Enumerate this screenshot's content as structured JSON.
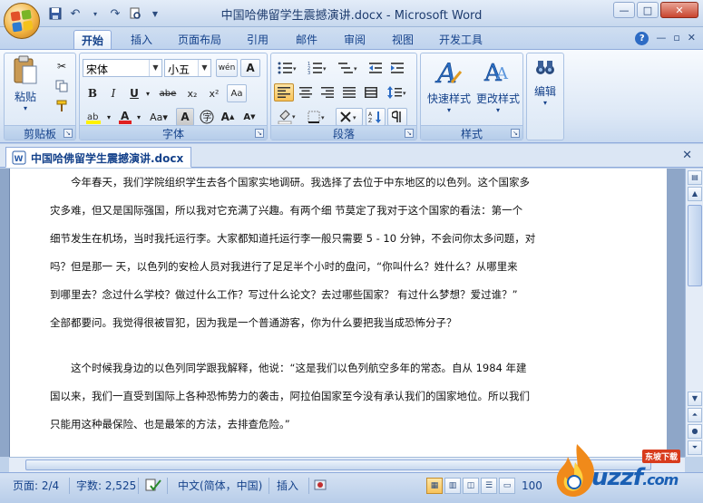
{
  "window": {
    "title": "中国哈佛留学生震撼演讲.docx - Microsoft Word",
    "controls": {
      "minimize": "—",
      "maximize": "□",
      "close": "✕"
    }
  },
  "qat": {
    "save": "save-icon",
    "undo": "undo-icon",
    "redo": "redo-icon",
    "customize": "▼"
  },
  "tabs": [
    {
      "label": "开始",
      "active": true
    },
    {
      "label": "插入"
    },
    {
      "label": "页面布局"
    },
    {
      "label": "引用"
    },
    {
      "label": "邮件"
    },
    {
      "label": "审阅"
    },
    {
      "label": "视图"
    },
    {
      "label": "开发工具"
    }
  ],
  "ribbon": {
    "clipboard": {
      "label": "剪贴板",
      "paste": "粘贴"
    },
    "font": {
      "label": "字体",
      "font_name": "宋体",
      "font_size": "小五",
      "wen": "wén",
      "A_big": "A",
      "bold": "B",
      "italic": "I",
      "underline": "U",
      "strike": "abe",
      "subscript": "x₂",
      "superscript": "x²",
      "clear": "Aa"
    },
    "paragraph": {
      "label": "段落"
    },
    "styles": {
      "label": "样式",
      "quick_styles": "快速样式",
      "change_styles": "更改样式"
    },
    "editing": {
      "label": "编辑",
      "edit": "编辑"
    }
  },
  "doc_tab": {
    "label": "中国哈佛留学生震撼演讲.docx",
    "close": "✕"
  },
  "document": {
    "paragraphs": [
      {
        "lines": [
          "　　今年春天，我们学院组织学生去各个国家实地调研。我选择了去位于中东地区的以色列。这个国家多",
          "灾多难，但又是国际强国，所以我对它充满了兴趣。有两个细 节莫定了我对于这个国家的看法：第一个",
          "细节发生在机场，当时我托运行李。大家都知道托运行李一般只需要 5 - 10 分钟，不会问你太多问题，对",
          "吗？但是那一 天，以色列的安检人员对我进行了足足半个小时的盘问，“你叫什么？姓什么？从哪里来",
          "到哪里去？念过什么学校？做过什么工作？写过什么论文？去过哪些国家？ 有过什么梦想？爱过谁？”",
          "全部都要问。我觉得很被冒犯，因为我是一个普通游客，你为什么要把我当成恐怖分子？"
        ]
      },
      {
        "lines": [
          "　　这个时候我身边的以色列同学跟我解释，他说：“这是我们以色列航空多年的常态。自从 1984 年建",
          "国以来，我们一直受到国际上各种恐怖势力的袭击，阿拉伯国家至今没有承认我们的国家地位。所以我们",
          "只能用这种最保险、也是最笨的方法，去排查危险。”"
        ]
      }
    ]
  },
  "statusbar": {
    "page": "页面: 2/4",
    "words": "字数: 2,525",
    "language": "中文(简体，中国)",
    "mode": "插入",
    "zoom": "100"
  },
  "watermark": {
    "text": "uzzf",
    "com": ".com",
    "badge": "东坡下载"
  }
}
